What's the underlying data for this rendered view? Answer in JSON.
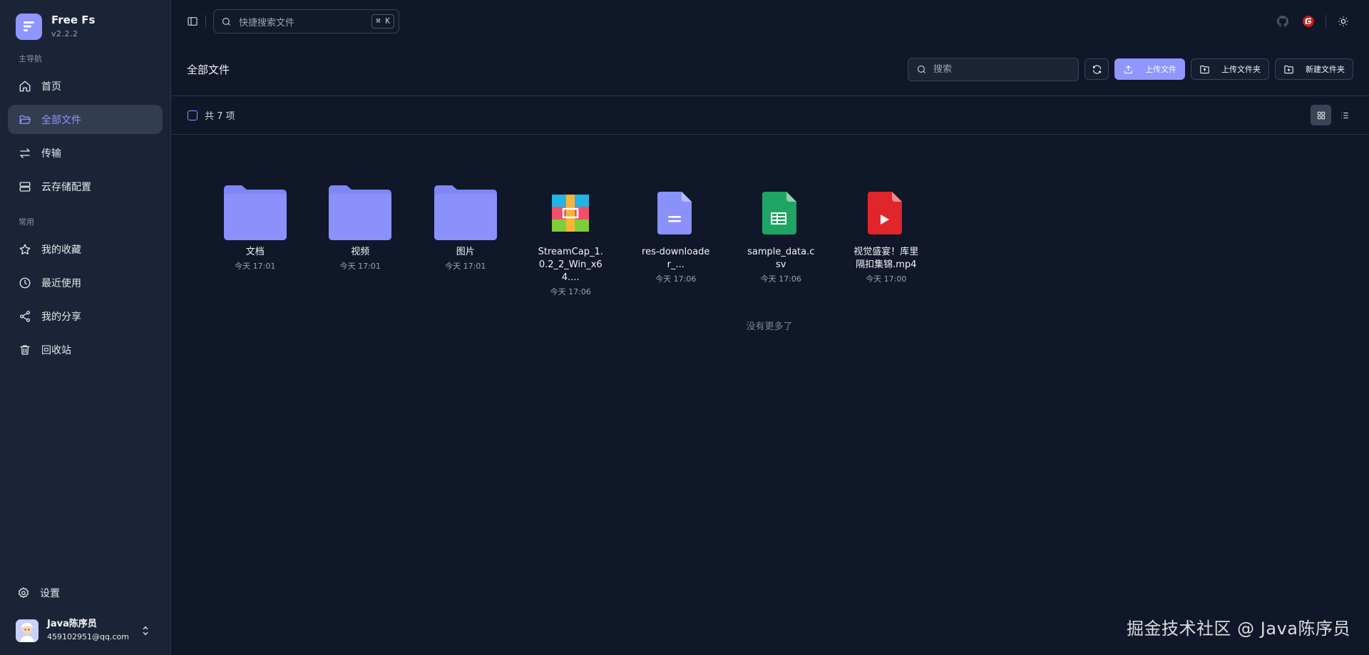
{
  "app": {
    "name": "Free Fs",
    "version": "v2.2.2"
  },
  "sidebar": {
    "section_main": "主导航",
    "main_items": [
      {
        "label": "首页",
        "icon": "home-icon"
      },
      {
        "label": "全部文件",
        "icon": "folder-open-icon",
        "active": true
      },
      {
        "label": "传输",
        "icon": "transfer-icon"
      },
      {
        "label": "云存储配置",
        "icon": "server-icon"
      }
    ],
    "section_common": "常用",
    "common_items": [
      {
        "label": "我的收藏",
        "icon": "star-icon"
      },
      {
        "label": "最近使用",
        "icon": "clock-icon"
      },
      {
        "label": "我的分享",
        "icon": "share-icon"
      },
      {
        "label": "回收站",
        "icon": "trash-icon"
      }
    ],
    "settings_label": "设置",
    "user": {
      "name": "Java陈序员",
      "email": "459102951@qq.com"
    }
  },
  "topbar": {
    "quick_search_placeholder": "快捷搜索文件",
    "shortcut": "⌘ K"
  },
  "header": {
    "title": "全部文件",
    "search_placeholder": "搜索",
    "upload_file": "上传文件",
    "upload_folder": "上传文件夹",
    "new_folder": "新建文件夹"
  },
  "toolbar": {
    "count_text": "共 7 项"
  },
  "files": [
    {
      "name": "文档",
      "time": "今天 17:01",
      "type": "folder"
    },
    {
      "name": "视频",
      "time": "今天 17:01",
      "type": "folder"
    },
    {
      "name": "图片",
      "time": "今天 17:01",
      "type": "folder"
    },
    {
      "name": "StreamCap_1.0.2_2_Win_x64....",
      "time": "今天 17:06",
      "type": "archive"
    },
    {
      "name": "res-downloader_...",
      "time": "今天 17:06",
      "type": "document"
    },
    {
      "name": "sample_data.csv",
      "time": "今天 17:06",
      "type": "spreadsheet"
    },
    {
      "name": "视觉盛宴！库里隔扣集锦.mp4",
      "time": "今天 17:00",
      "type": "video"
    }
  ],
  "end_text": "没有更多了",
  "watermark": "掘金技术社区 @ Java陈序员",
  "colors": {
    "accent": "#8f96ff",
    "background": "#0f1729",
    "sidebar": "#1b2436"
  }
}
